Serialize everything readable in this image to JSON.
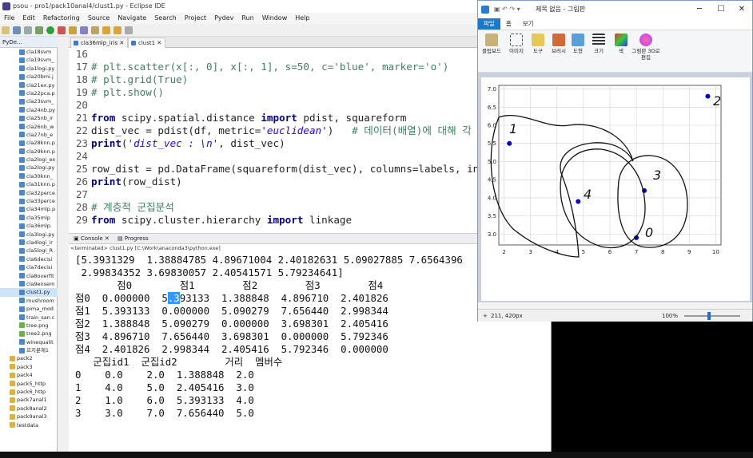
{
  "eclipse": {
    "title": "psou - pro1/pack10anal4/clust1.py - Eclipse IDE",
    "menu": [
      "File",
      "Edit",
      "Refactoring",
      "Source",
      "Navigate",
      "Search",
      "Project",
      "Pydev",
      "Run",
      "Window",
      "Help"
    ],
    "explorer_tab": "PyDe...",
    "explorer_items": [
      "cla18svm",
      "cla19svm_",
      "cla1logi.py",
      "cla20bmi.j",
      "cla21ex.py",
      "cla22pca.p",
      "cla23svm_",
      "cla24nb.py",
      "cla25nb_ir",
      "cla26nb_w",
      "cla27nb_e",
      "cla28knn.p",
      "cla29knn.p",
      "cla2logi_ex",
      "cla2logi.py",
      "cla30knn_",
      "cla31knn.p",
      "cla32perce",
      "cla33perce",
      "cla34mlp.p",
      "cla35mlp",
      "cla36mlp.",
      "cla3logi.py",
      "cla4logi_ir",
      "cla5logi_R",
      "cla6decisi",
      "cla7decisi",
      "cla8overfit",
      "cla9ensem",
      "clust1.py",
      "mushroom",
      "pima_mod",
      "train_san.c",
      "tree.png",
      "tree2.png",
      "winequalit",
      "르지분제1",
      "pack2",
      "pack3",
      "pack4",
      "pack5_http",
      "pack6_http",
      "pack7anal1",
      "pack8anal2",
      "pack9anal3",
      "testdata"
    ],
    "editor_tabs": [
      "cla36mlp_iris",
      "clust1"
    ],
    "code_lines": [
      {
        "n": "16",
        "t": ""
      },
      {
        "n": "17",
        "t": "# plt.scatter(x[:, 0], x[:, 1], s=50, c='blue', marker='o')"
      },
      {
        "n": "18",
        "t": "# plt.grid(True)"
      },
      {
        "n": "19",
        "t": "# plt.show()"
      },
      {
        "n": "20",
        "t": ""
      },
      {
        "n": "21",
        "t": "from scipy.spatial.distance import pdist, squareform"
      },
      {
        "n": "22",
        "t": "dist_vec = pdist(df, metric='euclidean')   # 데이터(배열)에 대해 각 요소"
      },
      {
        "n": "23",
        "t": "print('dist_vec : \\n', dist_vec)"
      },
      {
        "n": "24",
        "t": ""
      },
      {
        "n": "25",
        "t": "row_dist = pd.DataFrame(squareform(dist_vec), columns=labels, inde"
      },
      {
        "n": "26",
        "t": "print(row_dist)"
      },
      {
        "n": "27",
        "t": ""
      },
      {
        "n": "28",
        "t": "# 계층적 군집분석"
      },
      {
        "n": "29",
        "t": "from scipy.cluster.hierarchy import linkage"
      }
    ],
    "console_tabs": [
      "Console",
      "Progress"
    ],
    "console_path": "<terminated> clust1.py [C:\\Work\\anaconda3\\python.exe]",
    "console_lines": [
      "[5.3931329  1.38884785 4.89671004 2.40182631 5.09027885 7.6564396",
      " 2.99834352 3.69830057 2.40541571 5.79234641]",
      "       점0        점1        점2        점3        점4",
      "점0  0.000000  5.393133  1.388848  4.896710  2.401826",
      "점1  5.393133  0.000000  5.090279  7.656440  2.998344",
      "점2  1.388848  5.090279  0.000000  3.698301  2.405416",
      "점3  4.896710  7.656440  3.698301  0.000000  5.792346",
      "점4  2.401826  2.998344  2.405416  5.792346  0.000000",
      "   군집id1  군집id2        거리  멤버수",
      "0    0.0    2.0  1.388848  2.0",
      "1    4.0    5.0  2.405416  3.0",
      "2    1.0    6.0  5.393133  4.0",
      "3    3.0    7.0  7.656440  5.0"
    ]
  },
  "paint": {
    "title": "제목 없음 - 그림판",
    "tabs": [
      "파일",
      "홈",
      "보기"
    ],
    "ribbon": [
      "클립보드",
      "이미지",
      "도구",
      "브러시",
      "도형",
      "크기",
      "색",
      "그림판 3D로 편집"
    ],
    "status_pos": "211, 420px",
    "zoom": "100%",
    "win_controls": [
      "─",
      "☐",
      "✕"
    ]
  },
  "chart_data": {
    "type": "scatter",
    "x": [
      2.2,
      9.7,
      4.8,
      7.3,
      7.0
    ],
    "y": [
      5.5,
      6.8,
      3.9,
      4.2,
      2.9
    ],
    "x_ticks": [
      "2",
      "3",
      "4",
      "5",
      "6",
      "7",
      "8",
      "9",
      "10"
    ],
    "y_ticks": [
      "7.0",
      "6.5",
      "6.0",
      "5.5",
      "5.0",
      "4.5",
      "4.0",
      "3.5",
      "3.0"
    ],
    "xlim": [
      1.8,
      10.2
    ],
    "ylim": [
      2.7,
      7.1
    ],
    "grid": true,
    "annotations": [
      "1",
      "2",
      "3",
      "4",
      "0"
    ],
    "colors": {
      "points": "#0000cc"
    }
  }
}
